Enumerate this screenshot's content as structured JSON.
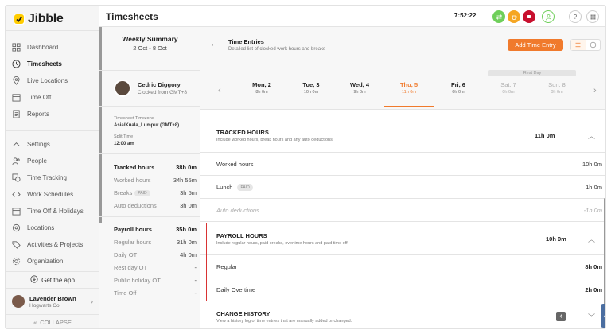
{
  "app": {
    "name": "Jibble",
    "page_title": "Timesheets",
    "clock": "7:52:22"
  },
  "colors": {
    "accent": "#f07a2c",
    "highlight": "#d93333",
    "brand": "#ffcc00"
  },
  "sidebar": {
    "items": [
      {
        "label": "Dashboard",
        "icon": "dashboard-icon"
      },
      {
        "label": "Timesheets",
        "icon": "clock-icon",
        "active": true
      },
      {
        "label": "Live Locations",
        "icon": "location-pin-icon"
      },
      {
        "label": "Time Off",
        "icon": "calendar-icon"
      },
      {
        "label": "Reports",
        "icon": "report-icon"
      }
    ],
    "settings_items": [
      {
        "label": "Settings",
        "icon": "chevron-up-icon"
      },
      {
        "label": "People",
        "icon": "people-icon"
      },
      {
        "label": "Time Tracking",
        "icon": "time-tracking-icon"
      },
      {
        "label": "Work Schedules",
        "icon": "schedule-icon"
      },
      {
        "label": "Time Off & Holidays",
        "icon": "calendar-icon"
      },
      {
        "label": "Locations",
        "icon": "location-pin-icon"
      },
      {
        "label": "Activities & Projects",
        "icon": "tag-icon"
      },
      {
        "label": "Organization",
        "icon": "gear-icon"
      }
    ],
    "get_app": "Get the app",
    "user": {
      "name": "Lavender Brown",
      "org": "Hogwarts Co"
    },
    "collapse": "COLLAPSE"
  },
  "summary": {
    "title": "Weekly Summary",
    "dates": "2 Oct - 8 Oct",
    "employee": {
      "name": "Cedric Diggory",
      "status": "Clocked from GMT+8"
    },
    "timezone_label": "Timesheet Timezone",
    "timezone_value": "Asia/Kuala_Lumpur (GMT+8)",
    "split_label": "Split Time",
    "split_value": "12:00 am",
    "tracked": [
      {
        "label": "Tracked hours",
        "value": "38h 0m",
        "bold": true
      },
      {
        "label": "Worked hours",
        "value": "34h 55m"
      },
      {
        "label": "Breaks",
        "value": "3h 5m",
        "tag": "PAID"
      },
      {
        "label": "Auto deductions",
        "value": "3h 0m"
      }
    ],
    "payroll": [
      {
        "label": "Payroll hours",
        "value": "35h 0m",
        "bold": true
      },
      {
        "label": "Regular hours",
        "value": "31h 0m"
      },
      {
        "label": "Daily OT",
        "value": "4h 0m"
      },
      {
        "label": "Rest day OT",
        "value": "-"
      },
      {
        "label": "Public holiday OT",
        "value": "-"
      },
      {
        "label": "Time Off",
        "value": "-"
      }
    ]
  },
  "entries": {
    "title": "Time Entries",
    "subtitle": "Detailed list of clocked work hours and breaks",
    "add_button": "Add Time Entry",
    "rest_day": "Rest Day",
    "days": [
      {
        "name": "Mon, 2",
        "hours": "8h 0m"
      },
      {
        "name": "Tue, 3",
        "hours": "10h 0m"
      },
      {
        "name": "Wed, 4",
        "hours": "9h 0m"
      },
      {
        "name": "Thu, 5",
        "hours": "11h 0m",
        "active": true
      },
      {
        "name": "Fri, 6",
        "hours": "0h 0m"
      },
      {
        "name": "Sat, 7",
        "hours": "0h 0m",
        "rest": true
      },
      {
        "name": "Sun, 8",
        "hours": "0h 0m",
        "rest": true
      }
    ],
    "tracked": {
      "title": "TRACKED HOURS",
      "subtitle": "Include worked hours, break hours and any auto deductions.",
      "total": "11h 0m",
      "rows": [
        {
          "label": "Worked hours",
          "value": "10h 0m"
        },
        {
          "label": "Lunch",
          "value": "1h 0m",
          "tag": "PAID"
        },
        {
          "label": "Auto deductions",
          "value": "-1h 0m"
        }
      ]
    },
    "payroll": {
      "title": "PAYROLL HOURS",
      "subtitle": "Include regular hours, paid breaks, overtime hours and paid time off.",
      "total": "10h 0m",
      "rows": [
        {
          "label": "Regular",
          "value": "8h 0m"
        },
        {
          "label": "Daily Overtime",
          "value": "2h 0m"
        }
      ]
    },
    "history": {
      "title": "CHANGE HISTORY",
      "subtitle": "View a history log of time entries that are manually added or changed.",
      "count": "4"
    }
  }
}
